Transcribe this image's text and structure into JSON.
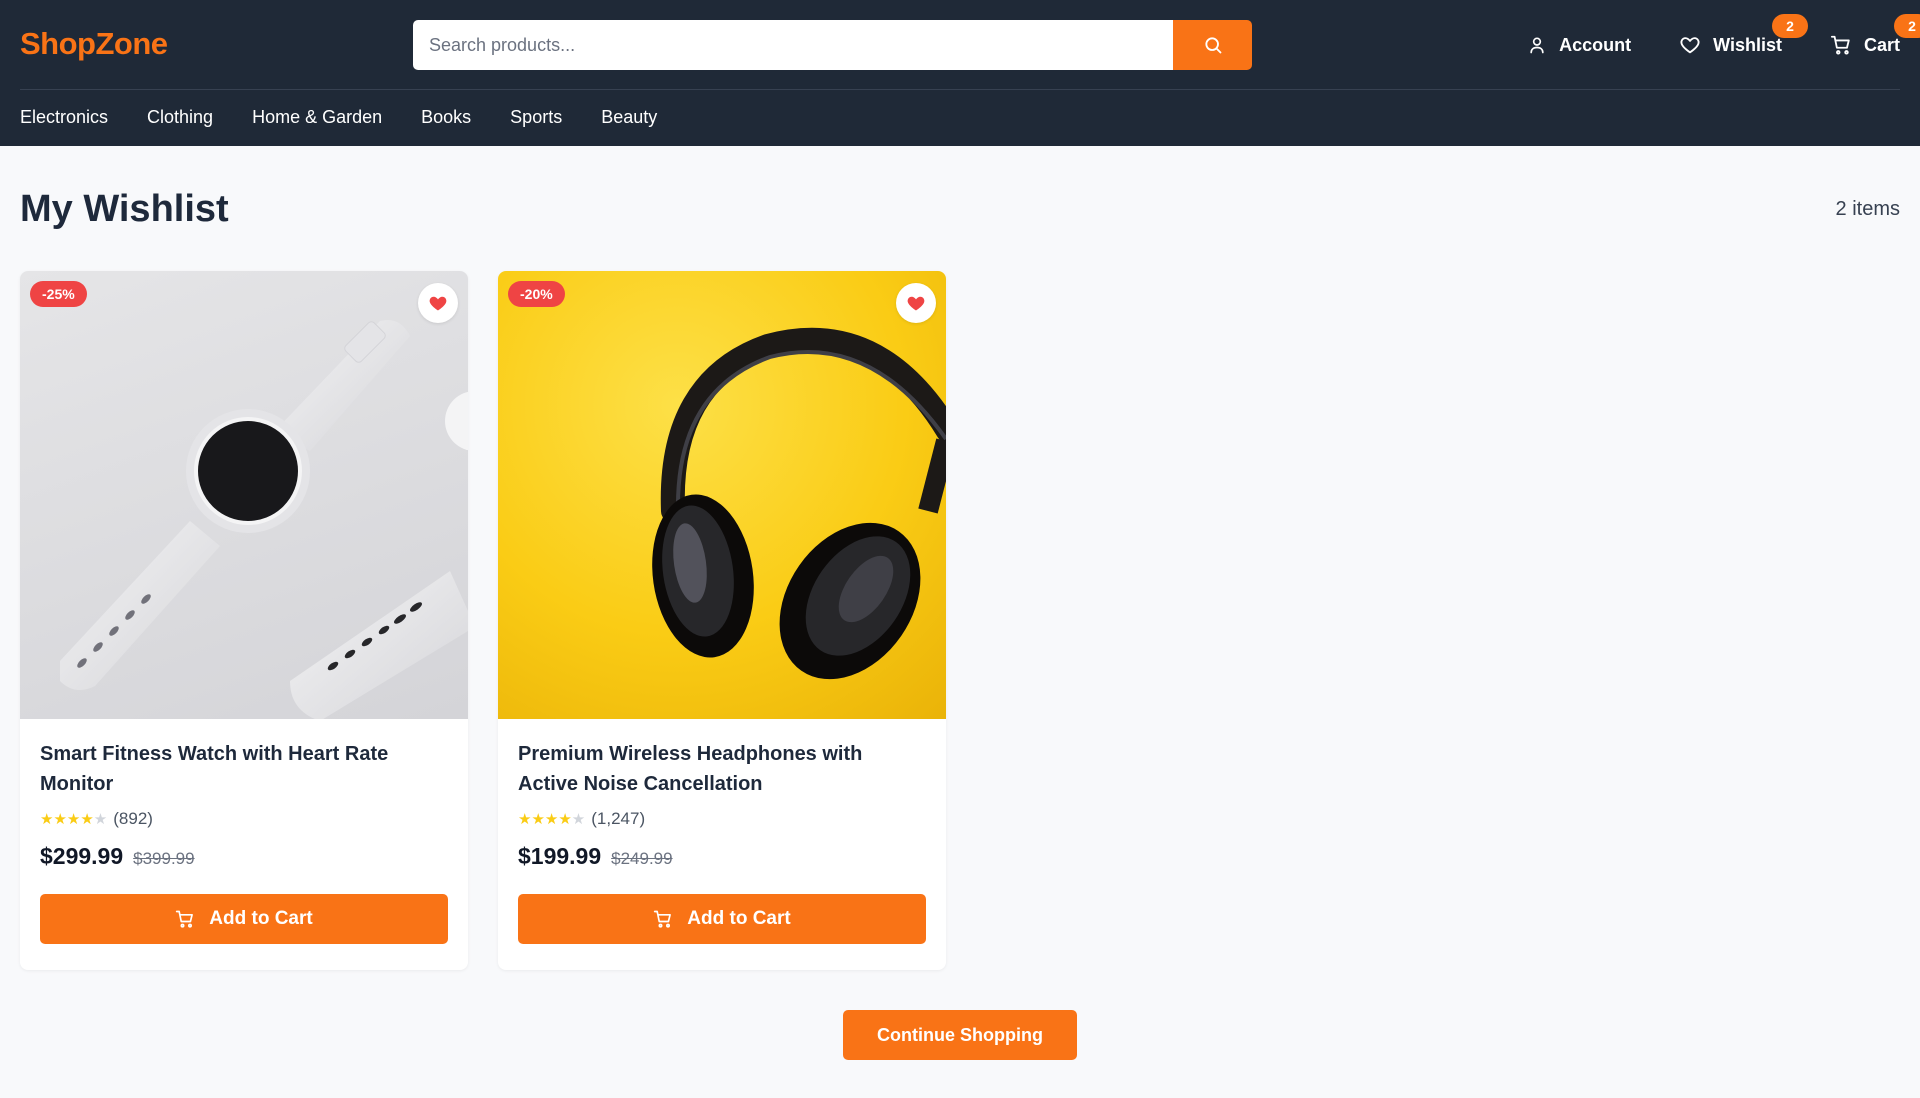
{
  "header": {
    "logo": "ShopZone",
    "search": {
      "placeholder": "Search products..."
    },
    "account_label": "Account",
    "wishlist_label": "Wishlist",
    "wishlist_count": "2",
    "cart_label": "Cart",
    "cart_count": "2",
    "colors": {
      "background": "#1f2937",
      "accent": "#f97316"
    }
  },
  "nav": {
    "items": [
      {
        "label": "Electronics"
      },
      {
        "label": "Clothing"
      },
      {
        "label": "Home & Garden"
      },
      {
        "label": "Books"
      },
      {
        "label": "Sports"
      },
      {
        "label": "Beauty"
      }
    ]
  },
  "main": {
    "title": "My Wishlist",
    "item_count": "2 items",
    "products": [
      {
        "discount": "-25%",
        "name": "Smart Fitness Watch with Heart Rate Monitor",
        "rating": 4,
        "reviews": "(892)",
        "price": "$299.99",
        "old_price": "$399.99",
        "button_label": "Add to Cart",
        "image": "smartwatch"
      },
      {
        "discount": "-20%",
        "name": "Premium Wireless Headphones with Active Noise Cancellation",
        "rating": 4,
        "reviews": "(1,247)",
        "price": "$199.99",
        "old_price": "$249.99",
        "button_label": "Add to Cart",
        "image": "headphones"
      }
    ],
    "continue_label": "Continue Shopping"
  }
}
